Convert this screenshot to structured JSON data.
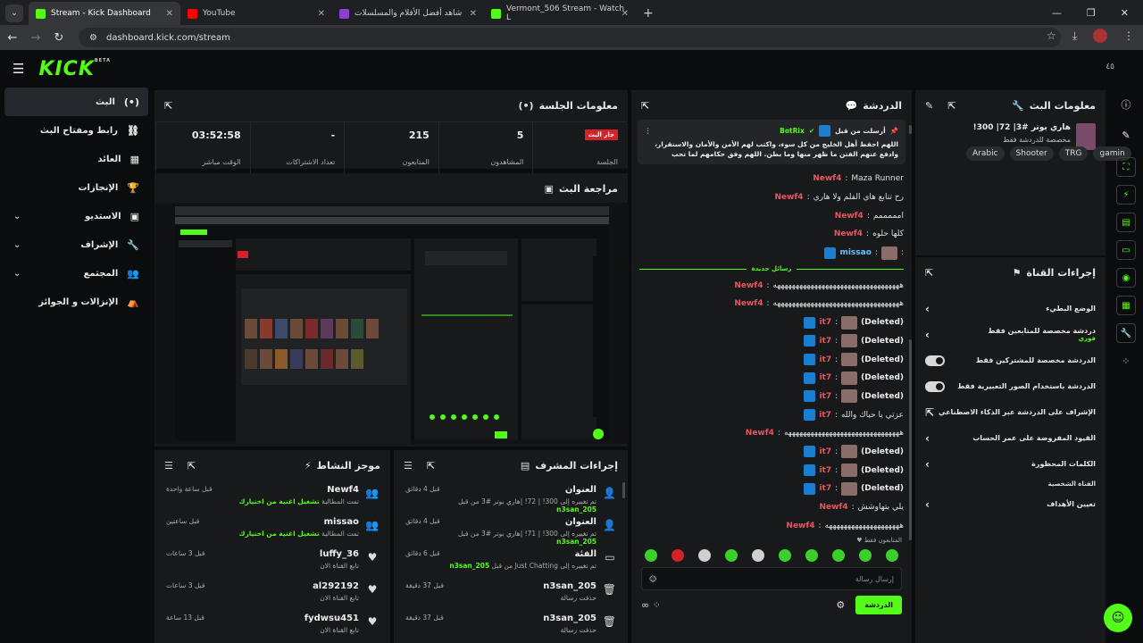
{
  "browser": {
    "tabs": [
      {
        "title": "Stream - Kick Dashboard",
        "color": "#53fc18",
        "active": true
      },
      {
        "title": "YouTube",
        "color": "#ff0000",
        "active": false
      },
      {
        "title": "شاهد أفضل الأفلام والمسلسلات",
        "color": "#8a3fd1",
        "active": false
      },
      {
        "title": "Vermont_506 Stream - Watch L",
        "color": "#53fc18",
        "active": false
      }
    ],
    "url": "dashboard.kick.com/stream"
  },
  "app": {
    "logo": "KICK",
    "logo_sup": "BETA",
    "topbar_right": "٤٥"
  },
  "nav": {
    "items": [
      {
        "label": "البث",
        "icon": "(•)",
        "active": true,
        "extra": ""
      },
      {
        "label": "رابط ومفتاح البث",
        "icon": "⛓",
        "active": false,
        "extra": ""
      },
      {
        "label": "العائد",
        "icon": "▦",
        "active": false,
        "extra": ""
      },
      {
        "label": "الإنجازات",
        "icon": "🏆",
        "active": false,
        "extra": ""
      },
      {
        "label": "الاستديو",
        "icon": "▣",
        "active": false,
        "extra": "⌄"
      },
      {
        "label": "الإشراف",
        "icon": "🔧",
        "active": false,
        "extra": "⌄"
      },
      {
        "label": "المجتمع",
        "icon": "👥",
        "active": false,
        "extra": "⌄"
      },
      {
        "label": "الإنزالات و الجوائز",
        "icon": "⛺",
        "active": false,
        "extra": ""
      }
    ]
  },
  "session": {
    "title": "معلومات الجلسة",
    "stats": [
      {
        "value": "جار البث",
        "label": "الجلسة",
        "badge": true
      },
      {
        "value": "5",
        "label": "المشاهدون",
        "badge": false
      },
      {
        "value": "215",
        "label": "المتابعون",
        "badge": false
      },
      {
        "value": "-",
        "label": "تعداد الاشتراكات",
        "badge": false
      },
      {
        "value": "03:52:58",
        "label": "الوقت مباشر",
        "badge": false
      }
    ]
  },
  "preview": {
    "title": "مراجعة البث"
  },
  "activity": {
    "title": "موجز النشاط",
    "rows": [
      {
        "name": "Newf4",
        "time": "قبل ساعة واحدة",
        "pre": "تمت المطالبة",
        "hl": "تشغيل اغنية من اختيارك",
        "icon": "👥"
      },
      {
        "name": "missao",
        "time": "قبل ساعتين",
        "pre": "تمت المطالبة",
        "hl": "تشغيل اغنية من اختيارك",
        "icon": "👥"
      },
      {
        "name": "luffy_36",
        "time": "قبل 3 ساعات",
        "pre": "تابع القناة الان",
        "hl": "",
        "icon": "♥"
      },
      {
        "name": "al292192",
        "time": "قبل 3 ساعات",
        "pre": "تابع القناة الان",
        "hl": "",
        "icon": "♥"
      },
      {
        "name": "fydwsu451",
        "time": "قبل 13 ساعة",
        "pre": "تابع القناة الان",
        "hl": "",
        "icon": "♥"
      }
    ]
  },
  "modactions": {
    "title": "إجراءات المشرف",
    "rows": [
      {
        "name": "العنوان",
        "time": "قبل 4 دقائق",
        "pre": "تم تغييره إلى 300! | 72! |هاري بوتر #3 من قبل",
        "hl": "n3san_205",
        "icon": "👤"
      },
      {
        "name": "العنوان",
        "time": "قبل 4 دقائق",
        "pre": "تم تغييره إلى 300! | 71! |هاري بوتر #3 من قبل",
        "hl": "n3san_205",
        "icon": "👤"
      },
      {
        "name": "الفئة",
        "time": "قبل 6 دقائق",
        "pre": "تم تغييره إلى Just Chatting من قبل",
        "hl": "n3san_205",
        "icon": "▭"
      },
      {
        "name": "n3san_205",
        "time": "قبل 37 دقيقة",
        "pre": "حذفت رسالة",
        "hl": "",
        "icon": "🗑"
      },
      {
        "name": "n3san_205",
        "time": "قبل 37 دقيقة",
        "pre": "حذفت رسالة",
        "hl": "",
        "icon": "🗑"
      }
    ]
  },
  "chat": {
    "title": "الدردشة",
    "pinned_by": "أرسلت من قبل",
    "pinned_user": "BotRix",
    "pinned_text": "اللهم احفظ أهل الخليج من كل سوء، واكتب لهم الأمن والأمان والاستقرار، وادفع عنهم الفتن ما ظهر منها وما بطن. اللهم وفق حكامهم لما تحب وترضى، واجعلهم جميعًا في حفظك...",
    "messages_top": [
      {
        "user": "Newf4",
        "text": "Maza Runner",
        "mod": false,
        "emote": false
      },
      {
        "user": "Newf4",
        "text": "رح تتابع هاي الفلم ولا هاري",
        "mod": false,
        "emote": false
      },
      {
        "user": "Newf4",
        "text": "امممممم",
        "mod": false,
        "emote": false
      },
      {
        "user": "Newf4",
        "text": "كلها حلوه",
        "mod": false,
        "emote": false
      },
      {
        "user": "missao",
        "text": ":",
        "mod": true,
        "emote": true
      }
    ],
    "divider": "رسائل جديدة",
    "messages_bottom": [
      {
        "user": "Newf4",
        "text": "ههههههههههههههههههههههههههههههههههه",
        "mod": false,
        "emote": false
      },
      {
        "user": "Newf4",
        "text": "ههههههههههههههههههههههههههههههههههه",
        "mod": false,
        "emote": false
      },
      {
        "user": "it7",
        "text": "(Deleted)",
        "mod": true,
        "emote": true
      },
      {
        "user": "it7",
        "text": "(Deleted)",
        "mod": true,
        "emote": true
      },
      {
        "user": "it7",
        "text": "(Deleted)",
        "mod": true,
        "emote": true
      },
      {
        "user": "it7",
        "text": "(Deleted)",
        "mod": true,
        "emote": true
      },
      {
        "user": "it7",
        "text": "(Deleted)",
        "mod": true,
        "emote": true
      },
      {
        "user": "it7",
        "text": "عزتي يا حياك والله",
        "mod": true,
        "emote": false
      },
      {
        "user": "Newf4",
        "text": "هههههههههههههههههههههههههههههههه",
        "mod": false,
        "emote": false
      },
      {
        "user": "it7",
        "text": "(Deleted)",
        "mod": true,
        "emote": true
      },
      {
        "user": "it7",
        "text": "(Deleted)",
        "mod": true,
        "emote": true
      },
      {
        "user": "it7",
        "text": "(Deleted)",
        "mod": true,
        "emote": true
      },
      {
        "user": "Newf4",
        "text": "يلي بتهاوشش",
        "mod": false,
        "emote": false
      },
      {
        "user": "Newf4",
        "text": "ههههههههههههههههههههه",
        "mod": false,
        "emote": false
      }
    ],
    "followers_only": "المتابعون فقط",
    "input_placeholder": "إرسال رسالة",
    "send_label": "الدردشة",
    "emote_count": 10
  },
  "streaminfo": {
    "title": "معلومات البث",
    "stream_title": "هاري بوتر #3| 72| 300!",
    "category": "مخصصة للدردشة فقط",
    "tags": [
      "Arabic",
      "Shooter",
      "TRG",
      "gamin"
    ]
  },
  "channel_actions": {
    "title": "إجراءات القناة",
    "rows": [
      {
        "label": "الوضع البطيء",
        "sub": "",
        "control": "chevron"
      },
      {
        "label": "دردشة مخصصة للمتابعين فقط",
        "sub": "فوري",
        "control": "chevron"
      },
      {
        "label": "الدردشة مخصصة للمشتركين فقط",
        "sub": "",
        "control": "toggle"
      },
      {
        "label": "الدردشة باستخدام الصور التعبيرية فقط",
        "sub": "",
        "control": "toggle"
      },
      {
        "label": "الإشراف على الدردشة عبر الذكاء الاصطناعي",
        "sub": "",
        "control": "external"
      },
      {
        "label": "القيود المفروضة على عمر الحساب",
        "sub": "",
        "control": "chevron"
      },
      {
        "label": "الكلمات المحظورة",
        "sub": "",
        "control": "chevron"
      }
    ],
    "section_label": "القناة الشخصية",
    "goal_label": "تعيين الأهداف"
  }
}
